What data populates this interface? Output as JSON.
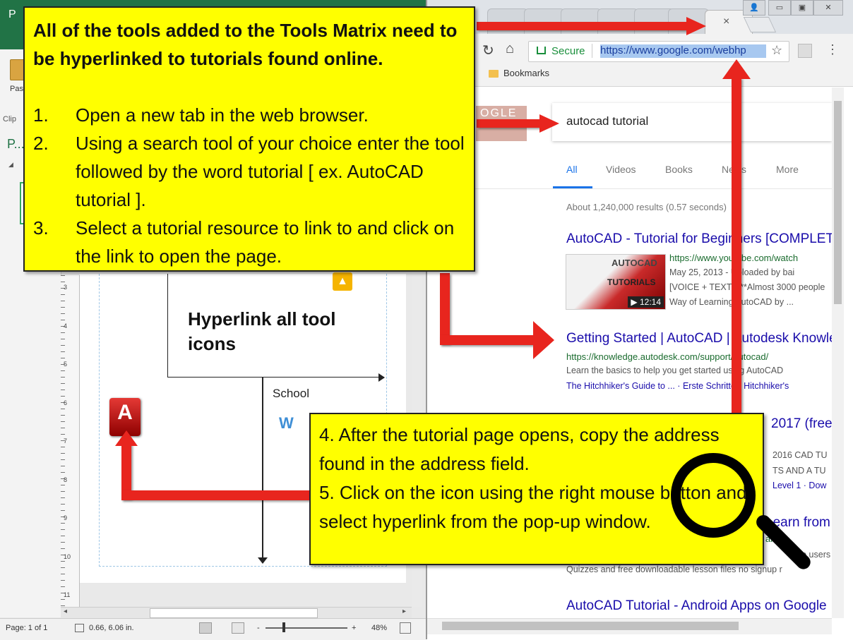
{
  "publisher": {
    "title_letter": "P",
    "ribbon": {
      "paste_label": "Pas",
      "clipboard_label": "Clip"
    },
    "pages_pane": {
      "label": "P..."
    },
    "ruler_numbers": [
      "3",
      "4",
      "5",
      "6",
      "7",
      "8",
      "9",
      "10",
      "11"
    ],
    "canvas": {
      "heading": "Hyperlink all tool icons",
      "school_label": "School"
    },
    "status_bar": {
      "page": "Page: 1 of 1",
      "position": "0.66, 6.06 in.",
      "zoom": "48%",
      "zoom_minus": "-",
      "zoom_plus": "+"
    }
  },
  "browser": {
    "tab_close": "×",
    "address_bar": {
      "secure_label": "Secure",
      "url": "https://www.google.com/webhp"
    },
    "bookmarks_label": "Bookmarks",
    "google": {
      "logo_text": "OGLE",
      "query": "autocad tutorial",
      "tabs": [
        "All",
        "Videos",
        "Books",
        "News",
        "More"
      ],
      "stats": "About 1,240,000 results (0.57 seconds)",
      "results": [
        {
          "title": "AutoCAD - Tutorial for Beginners [COMPLETE]",
          "url": "https://www.youtube.com/watch",
          "lines": [
            "May 25, 2013 - Uploaded by bai",
            "[VOICE + TEXT] ***Almost 3000 people",
            "Way of Learning AutoCAD by ..."
          ],
          "thumb": {
            "line1": "AUTOCAD",
            "line2": "TUTORIALS",
            "duration": "▶ 12:14"
          }
        },
        {
          "title": "Getting Started | AutoCAD | Autodesk Knowledge",
          "url": "https://knowledge.autodesk.com/support/autocad/",
          "lines": [
            "Learn the basics to help you get started using AutoCAD",
            "The Hitchhiker's Guide to ... · Erste Schritte · Hitchhiker's"
          ]
        },
        {
          "title": "2017 (free",
          "lines": [
            "2016 CAD TU",
            "TS AND A TU",
            "Level 1 · Dow"
          ]
        },
        {
          "title": "Learn from",
          "url": "als/ ▾",
          "lines": [
            "pro users",
            "Quizzes and free downloadable lesson files no signup r"
          ]
        },
        {
          "title": "AutoCAD Tutorial - Android Apps on Google"
        }
      ]
    }
  },
  "instructions": {
    "intro": "All of the tools added to the Tools Matrix need to be hyperlinked to tutorials found online.",
    "steps": [
      {
        "num": "1.",
        "text": "Open a new tab in the web browser."
      },
      {
        "num": "2.",
        "text": "Using a search tool of your choice enter the tool followed by the word tutorial [ ex. AutoCAD tutorial ]."
      },
      {
        "num": "3.",
        "text": "Select a tutorial resource to link to and click on the link to open the page."
      }
    ],
    "followup": [
      "4. After the tutorial page opens, copy the address found in the address field.",
      "5. Click on the icon using the right mouse button and select hyperlink from the pop-up window."
    ]
  },
  "colors": {
    "callout": "#ffff00",
    "arrow": "#e8251e",
    "publisher_green": "#217346",
    "link_blue": "#1a0dab"
  },
  "icons": [
    "reload-icon",
    "home-icon",
    "lock-icon",
    "star-icon",
    "menu-icon",
    "folder-icon",
    "autocad-icon",
    "drive-icon",
    "word-icon",
    "magnifier-icon"
  ]
}
